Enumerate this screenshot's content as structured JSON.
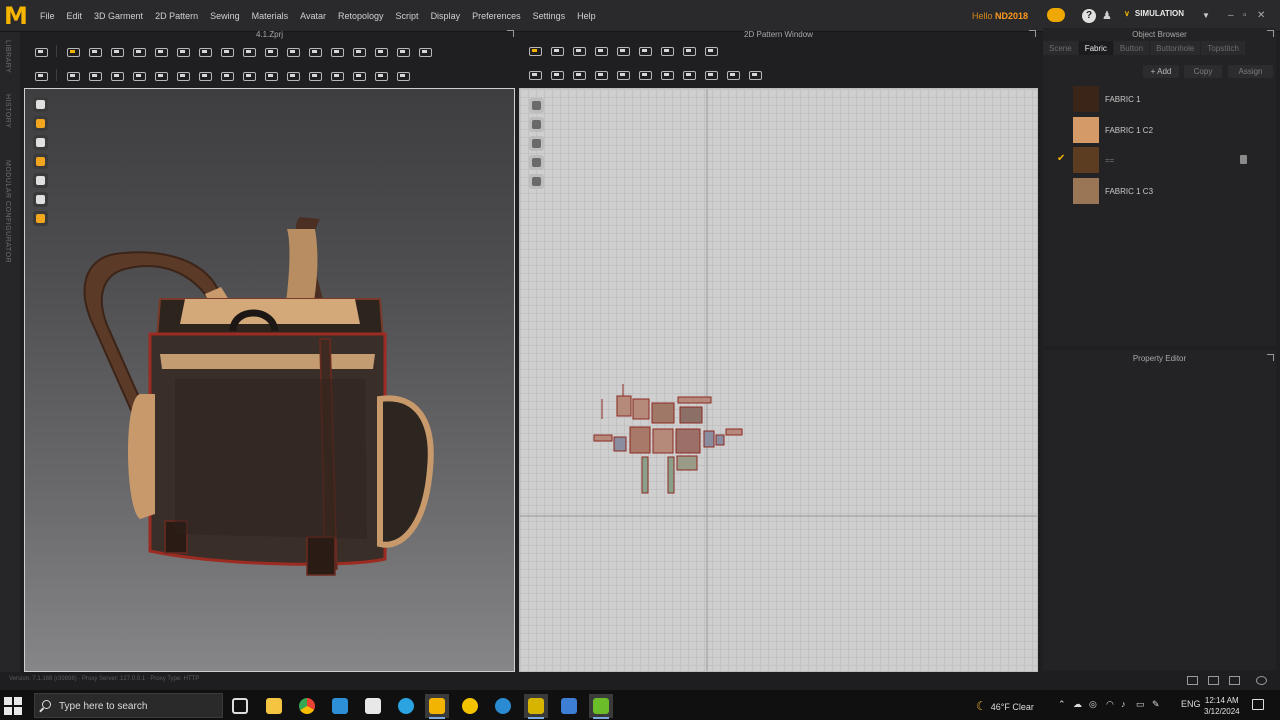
{
  "app": {
    "menus": [
      "File",
      "Edit",
      "3D Garment",
      "2D Pattern",
      "Sewing",
      "Materials",
      "Avatar",
      "Retopology",
      "Script",
      "Display",
      "Preferences",
      "Settings",
      "Help"
    ],
    "user_prefix": "Hello",
    "user_name": "ND2018",
    "mode": "SIMULATION"
  },
  "sidebar_labels": [
    "LIBRARY",
    "HISTORY",
    "MODULAR CONFIGURATOR"
  ],
  "viewport3d": {
    "title": "4.1.Zprj"
  },
  "pattern_window": {
    "title": "2D Pattern Window"
  },
  "object_browser": {
    "title": "Object Browser",
    "tabs": [
      "Scene",
      "Fabric",
      "Button",
      "Buttonhole",
      "Topstitch"
    ],
    "active_tab": "Fabric",
    "buttons": {
      "add": "+ Add",
      "copy": "Copy",
      "assign": "Assign"
    },
    "fabrics": [
      {
        "name": "FABRIC 1",
        "color": "#3b2518",
        "selected": false
      },
      {
        "name": "FABRIC 1 C2",
        "color": "#d49a68",
        "selected": false
      },
      {
        "name": "==",
        "color": "#5c3d21",
        "selected": true
      },
      {
        "name": "FABRIC 1 C3",
        "color": "#9a7657",
        "selected": false
      }
    ]
  },
  "property_editor": {
    "title": "Property Editor"
  },
  "status_bar": {
    "text": "Version: 7.1.168 (r39898) · Proxy Server: 127.0.0.1 · Proxy Type: HTTP"
  },
  "taskbar": {
    "search_placeholder": "Type here to search",
    "weather_temp": "46°F",
    "weather_desc": "Clear",
    "language": "ENG",
    "time": "12:14 AM",
    "date": "3/12/2024"
  }
}
